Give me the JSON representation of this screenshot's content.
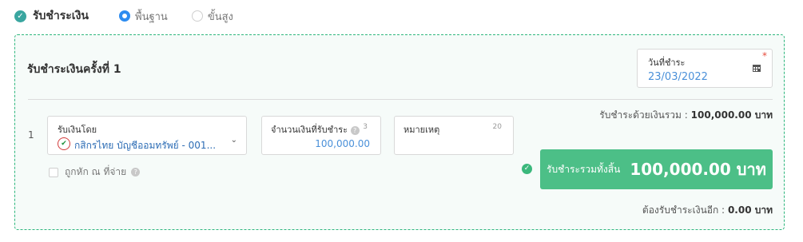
{
  "header": {
    "section_label": "รับชำระเงิน",
    "mode_options": [
      {
        "label": "พื้นฐาน",
        "selected": true
      },
      {
        "label": "ขั้นสูง",
        "selected": false
      }
    ]
  },
  "payment": {
    "title": "รับชำระเงินครั้งที่ 1",
    "date": {
      "label": "วันที่ชำระ",
      "required_mark": "*",
      "value": "23/03/2022"
    },
    "total_summary": {
      "label": "รับชำระด้วยเงินรวม :",
      "value": "100,000.00 บาท"
    },
    "rows": [
      {
        "index": "1",
        "received_by": {
          "label": "รับเงินโดย",
          "value": "กสิกรไทย บัญชีออมทรัพย์ - 001..."
        },
        "amount": {
          "label": "จำนวนเงินที่รับชำระ",
          "counter": "3",
          "value": "100,000.00"
        },
        "note": {
          "label": "หมายเหตุ",
          "counter": "20"
        },
        "withholding": {
          "label": "ถูกหัก ณ ที่จ่าย",
          "checked": false
        }
      }
    ],
    "grand_total": {
      "label": "รับชำระรวมทั้งสิ้น",
      "value": "100,000.00 บาท"
    },
    "remaining": {
      "label": "ต้องรับชำระเงินอีก :",
      "value": "0.00 บาท"
    }
  },
  "colors": {
    "accent": "#2fb77e",
    "button": "#4cbf87",
    "link": "#4a90d9"
  }
}
